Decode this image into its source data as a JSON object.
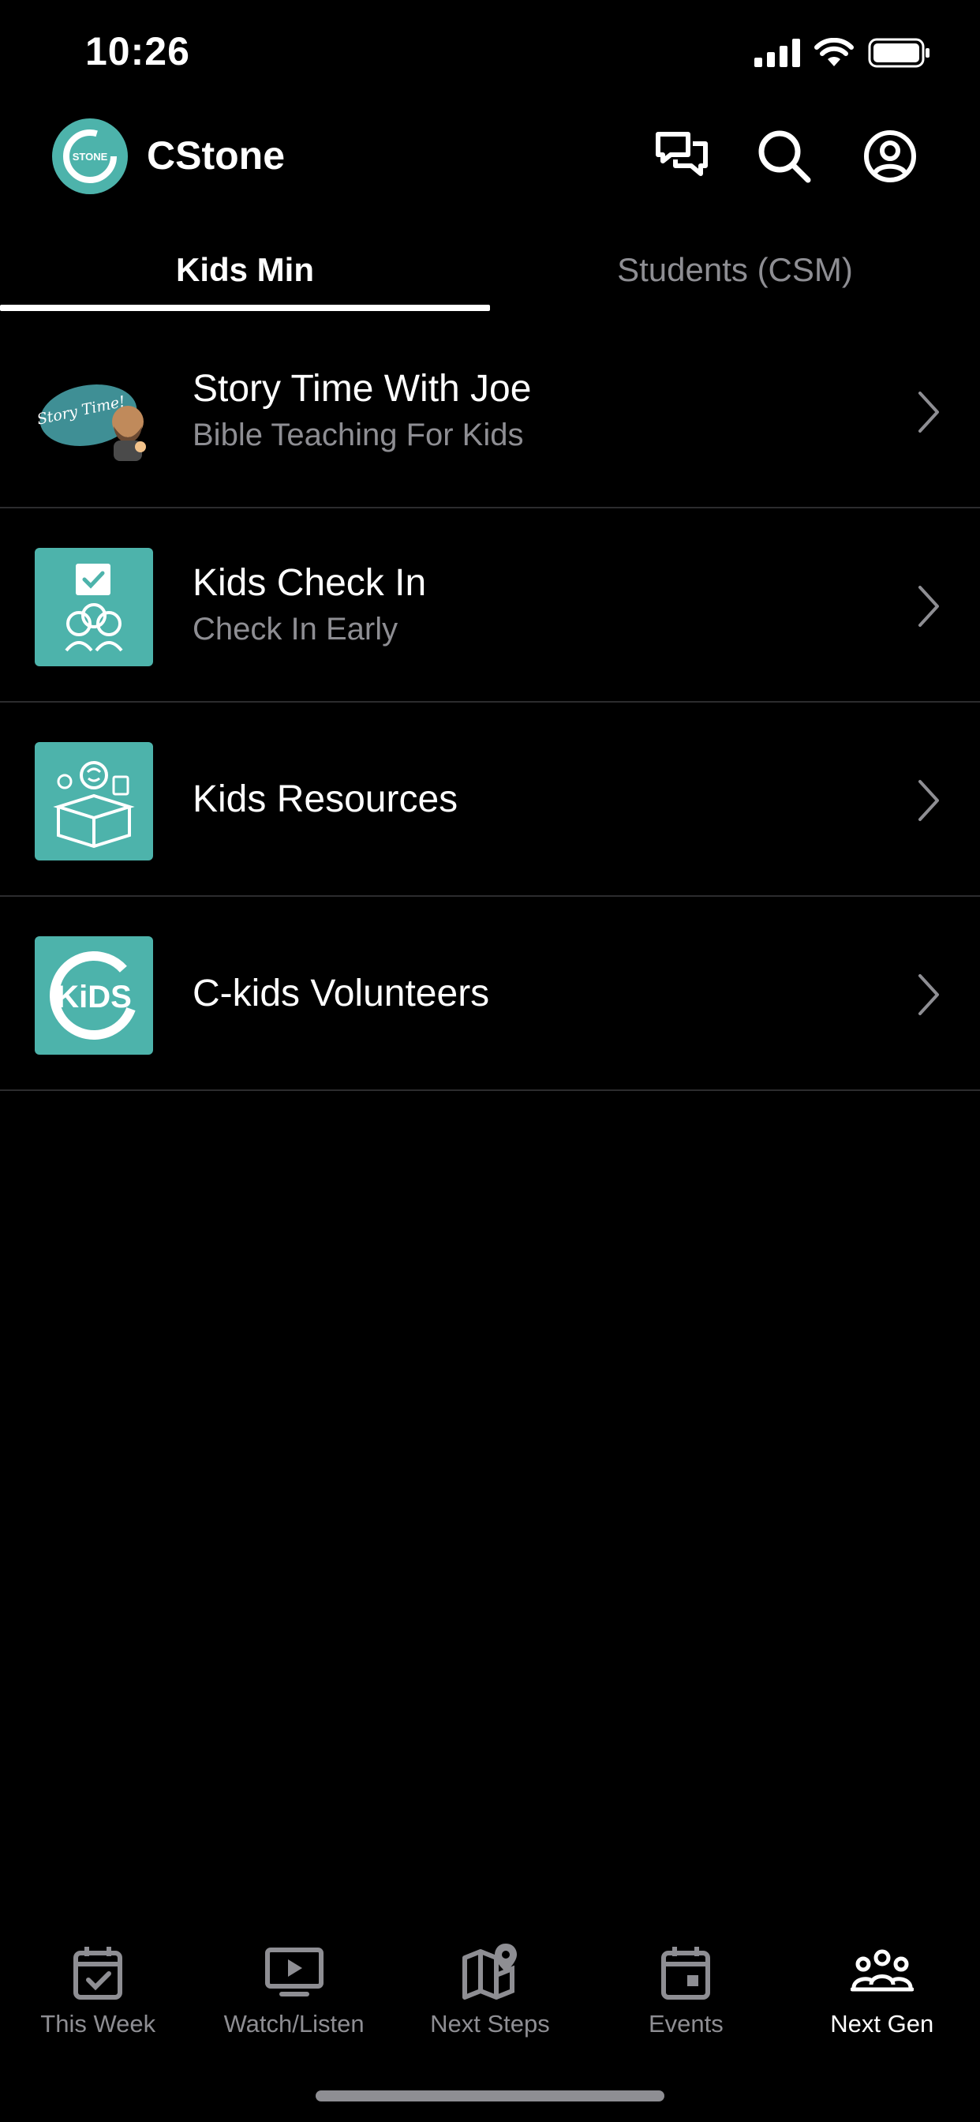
{
  "status_bar": {
    "time": "10:26"
  },
  "header": {
    "app_title": "CStone",
    "logo_text": "STONE"
  },
  "tabs": [
    {
      "label": "Kids Min",
      "active": true
    },
    {
      "label": "Students (CSM)",
      "active": false
    }
  ],
  "list": [
    {
      "title": "Story Time With Joe",
      "subtitle": "Bible Teaching For Kids",
      "thumb": "story-time",
      "thumb_text": "Story Time!"
    },
    {
      "title": "Kids Check In",
      "subtitle": "Check In Early",
      "thumb": "check-in"
    },
    {
      "title": "Kids Resources",
      "subtitle": "",
      "thumb": "resources"
    },
    {
      "title": "C-kids Volunteers",
      "subtitle": "",
      "thumb": "c-kids",
      "thumb_text": "KiDS"
    }
  ],
  "bottom_nav": [
    {
      "label": "This Week",
      "icon": "calendar-check-icon",
      "active": false
    },
    {
      "label": "Watch/Listen",
      "icon": "tv-play-icon",
      "active": false
    },
    {
      "label": "Next Steps",
      "icon": "map-pin-icon",
      "active": false
    },
    {
      "label": "Events",
      "icon": "calendar-icon",
      "active": false
    },
    {
      "label": "Next Gen",
      "icon": "people-group-icon",
      "active": true
    }
  ],
  "colors": {
    "accent": "#4db3ab",
    "background": "#000000",
    "muted_text": "#8e8e93",
    "divider": "#2c2c2e"
  }
}
